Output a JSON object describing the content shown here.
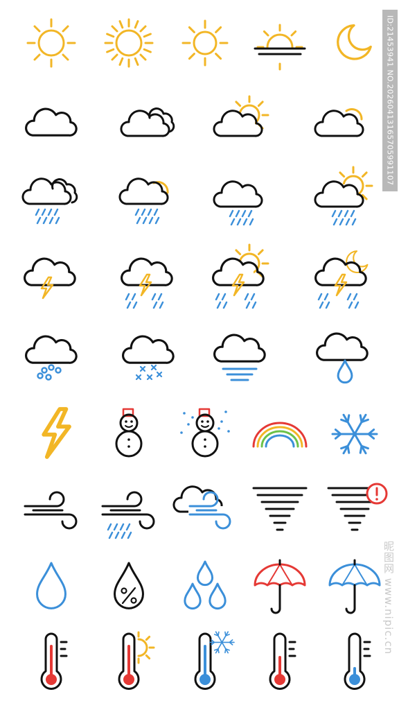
{
  "colors": {
    "stroke": "#111111",
    "sun": "#f2b626",
    "rain": "#3b8fd9",
    "red": "#e53935",
    "rainbow_green": "#6cc24a"
  },
  "badge_text": "ID:21453941 NO.20260413165705991107",
  "watermark_text": "昵图网 www.nipic.cn",
  "icons": [
    [
      "sun-icon",
      "sun-bright-icon",
      "sun-small-icon",
      "sunset-icon",
      "crescent-moon-icon"
    ],
    [
      "cloud-icon",
      "clouds-icon",
      "cloud-sun-icon",
      "cloud-sun-behind-icon"
    ],
    [
      "clouds-rain-icon",
      "cloud-sun-rain-small-icon",
      "cloud-rain-icon",
      "cloud-sun-rain-icon"
    ],
    [
      "cloud-lightning-icon",
      "cloud-lightning-rain-icon",
      "cloud-sun-lightning-icon",
      "cloud-moon-lightning-icon"
    ],
    [
      "cloud-hail-icon",
      "cloud-snow-icon",
      "cloud-fog-icon",
      "cloud-drop-icon"
    ],
    [
      "lightning-icon",
      "snowman-icon",
      "snowman-snowing-icon",
      "rainbow-icon",
      "snowflake-icon"
    ],
    [
      "wind-icon",
      "wind-rain-icon",
      "cloud-wind-icon",
      "tornado-icon",
      "tornado-warning-icon"
    ],
    [
      "drop-icon",
      "humidity-icon",
      "drops-icon",
      "umbrella-red-icon",
      "umbrella-blue-icon"
    ],
    [
      "thermometer-hot-icon",
      "thermometer-sun-icon",
      "thermometer-snow-icon",
      "thermometer-medium-icon",
      "thermometer-cold-icon"
    ]
  ]
}
